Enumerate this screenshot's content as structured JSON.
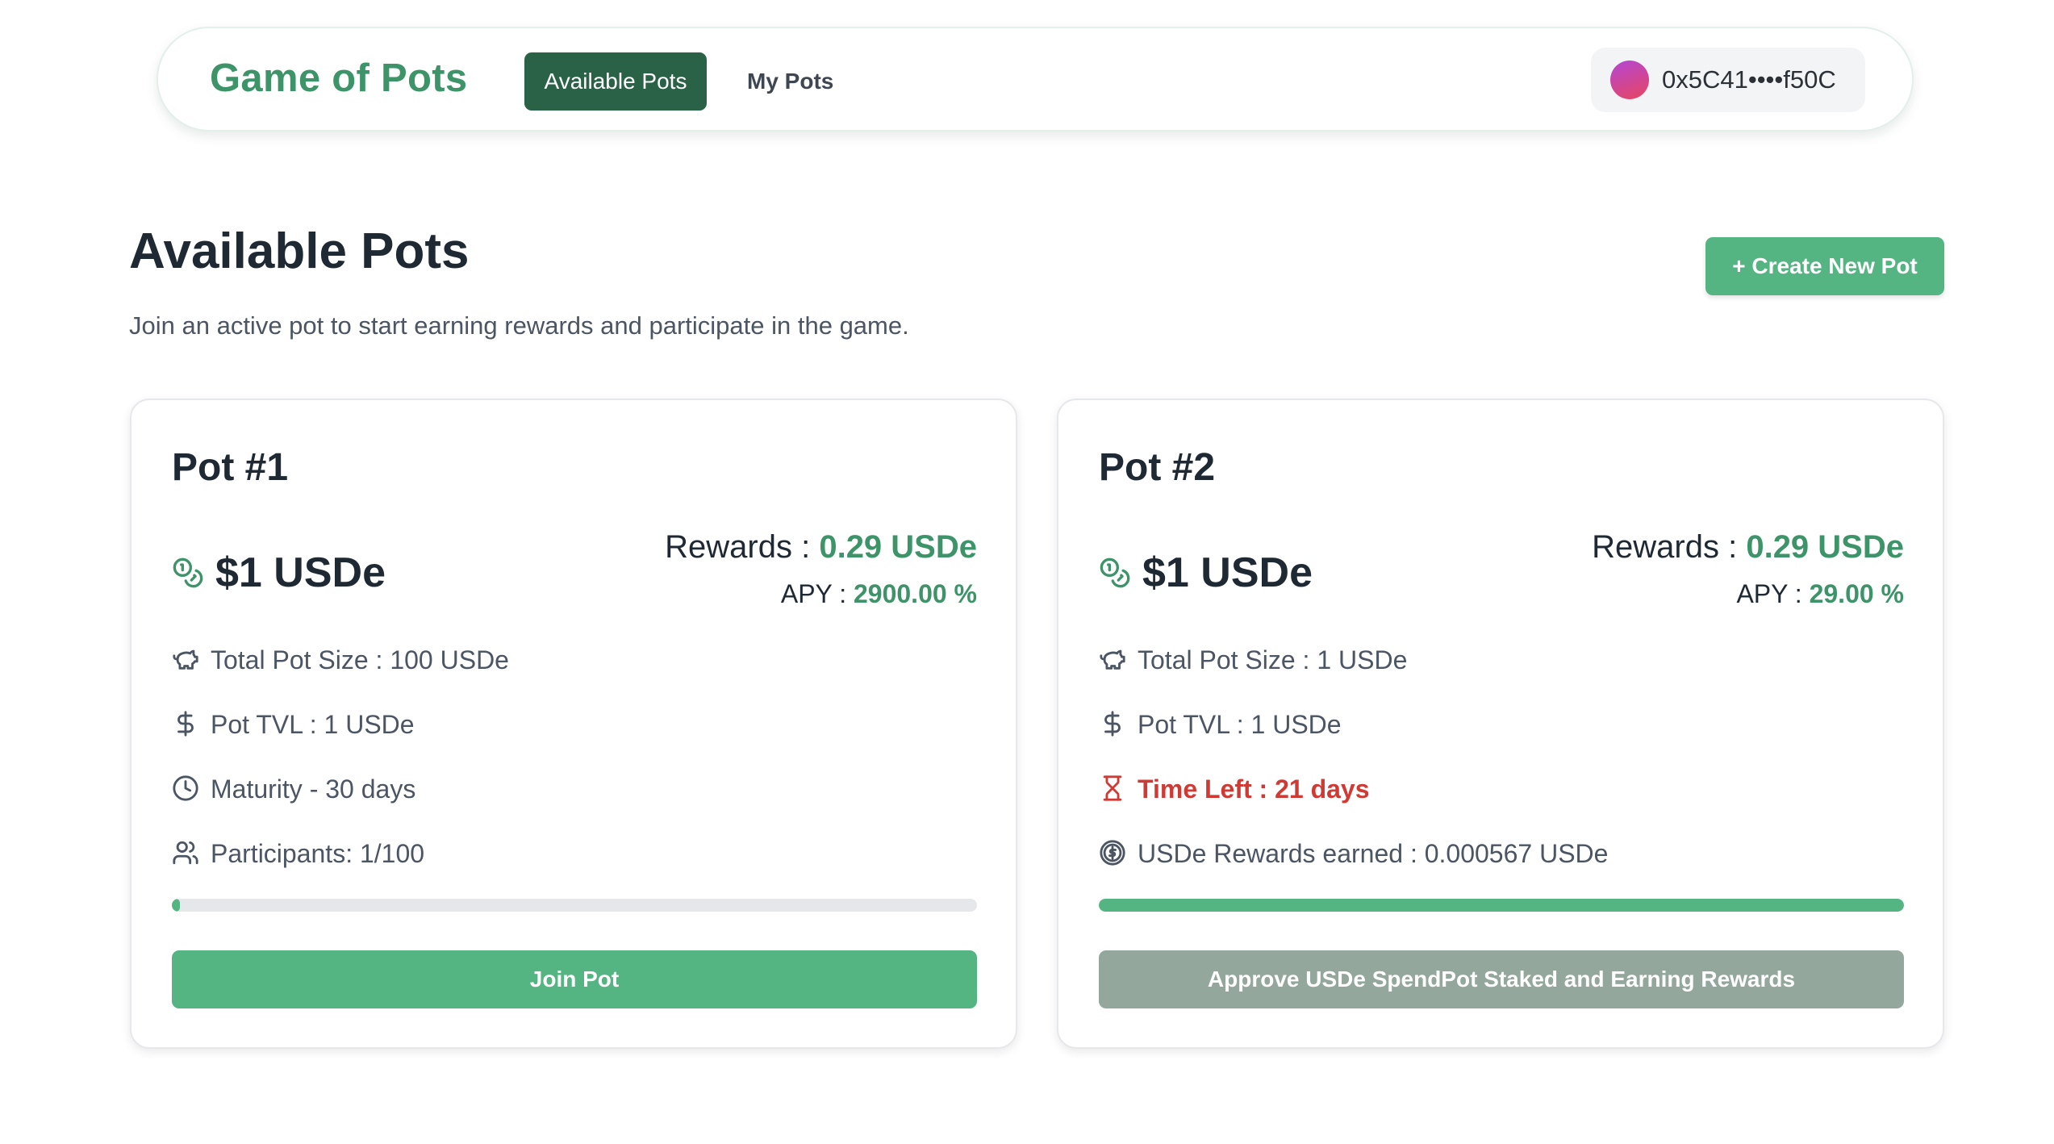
{
  "header": {
    "logo": "Game of Pots",
    "tabs": [
      {
        "label": "Available Pots",
        "active": true
      },
      {
        "label": "My Pots",
        "active": false
      }
    ],
    "wallet": {
      "address": "0x5C41••••f50C"
    }
  },
  "page": {
    "title": "Available Pots",
    "subtitle": "Join an active pot to start earning rewards and participate in the game.",
    "create_button": "+ Create New Pot"
  },
  "colors": {
    "brand_green": "#3e9469",
    "button_green": "#54b582",
    "active_tab": "#2a6248",
    "disabled_button": "#94a79d",
    "warning_red": "#d03a34"
  },
  "pots": [
    {
      "title": "Pot #1",
      "price": "$1 USDe",
      "rewards_label": "Rewards : ",
      "rewards_value": "0.29 USDe",
      "apy_label": "APY : ",
      "apy_value": "2900.00 %",
      "rows": [
        {
          "icon": "piggy-bank-icon",
          "text": "Total Pot Size : 100 USDe"
        },
        {
          "icon": "dollar-icon",
          "text": "Pot TVL : 1 USDe"
        },
        {
          "icon": "clock-icon",
          "text": "Maturity - 30 days"
        },
        {
          "icon": "users-icon",
          "text": "Participants: 1/100"
        }
      ],
      "progress": 0.01,
      "button": "Join Pot"
    },
    {
      "title": "Pot #2",
      "price": "$1 USDe",
      "rewards_label": "Rewards : ",
      "rewards_value": "0.29 USDe",
      "apy_label": "APY : ",
      "apy_value": "29.00 %",
      "rows": [
        {
          "icon": "piggy-bank-icon",
          "text": "Total Pot Size : 1 USDe"
        },
        {
          "icon": "dollar-icon",
          "text": "Pot TVL : 1 USDe"
        },
        {
          "icon": "hourglass-icon",
          "text": "Time Left : 21 days"
        },
        {
          "icon": "dollar-circle-icon",
          "text": "USDe Rewards earned : 0.000567 USDe"
        }
      ],
      "progress": 1.0,
      "button": "Approve USDe SpendPot Staked and Earning Rewards"
    }
  ]
}
